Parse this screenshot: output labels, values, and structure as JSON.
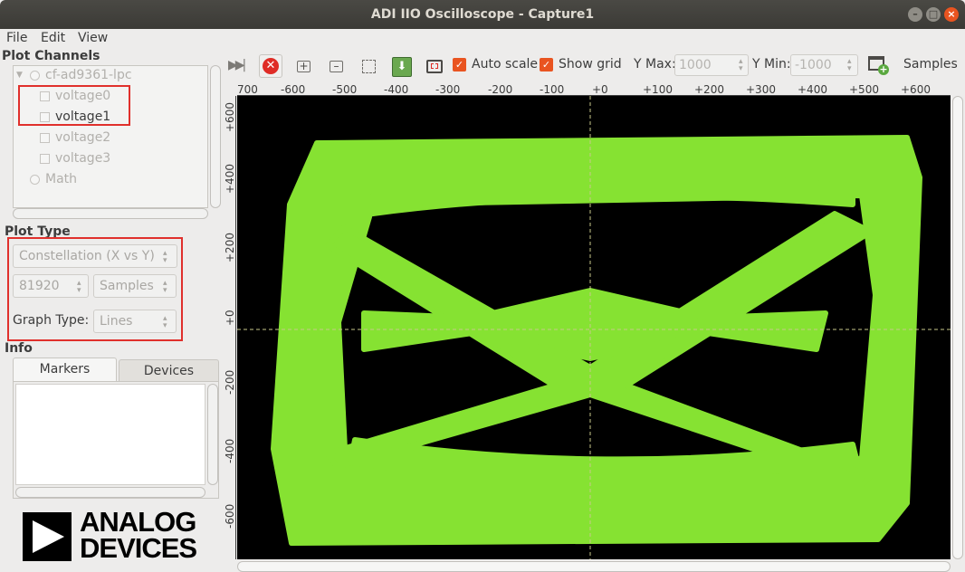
{
  "window": {
    "title": "ADI IIO Oscilloscope - Capture1"
  },
  "menu": [
    "File",
    "Edit",
    "View"
  ],
  "plot_channels": {
    "title": "Plot Channels",
    "device": "cf-ad9361-lpc",
    "channels": [
      "voltage0",
      "voltage1",
      "voltage2",
      "voltage3"
    ],
    "math": "Math"
  },
  "plot_type": {
    "title": "Plot Type",
    "type_value": "Constellation (X vs Y)",
    "sample_count": "81920",
    "sample_unit": "Samples",
    "graph_type_label": "Graph Type:",
    "graph_type_value": "Lines"
  },
  "info": {
    "title": "Info",
    "tabs": [
      "Markers",
      "Devices"
    ]
  },
  "logo": {
    "line1": "ANALOG",
    "line2": "DEVICES"
  },
  "toolbar": {
    "autoscale_label": "Auto scale",
    "showgrid_label": "Show grid",
    "ymax_label": "Y Max:",
    "ymax_value": "1000",
    "ymin_label": "Y Min:",
    "ymin_value": "-1000",
    "samples_label": "Samples"
  },
  "axes": {
    "x_ticks": [
      "700",
      "-600",
      "-500",
      "-400",
      "-300",
      "-200",
      "-100",
      "+0",
      "+100",
      "+200",
      "+300",
      "+400",
      "+500",
      "+600"
    ],
    "y_ticks": [
      "+600",
      "+400",
      "+200",
      "+0",
      "-200",
      "-400",
      "-600"
    ]
  },
  "colors": {
    "trace": "#86e232",
    "plot_bg": "#000000",
    "highlight": "#e0302c",
    "accent": "#e95420"
  }
}
